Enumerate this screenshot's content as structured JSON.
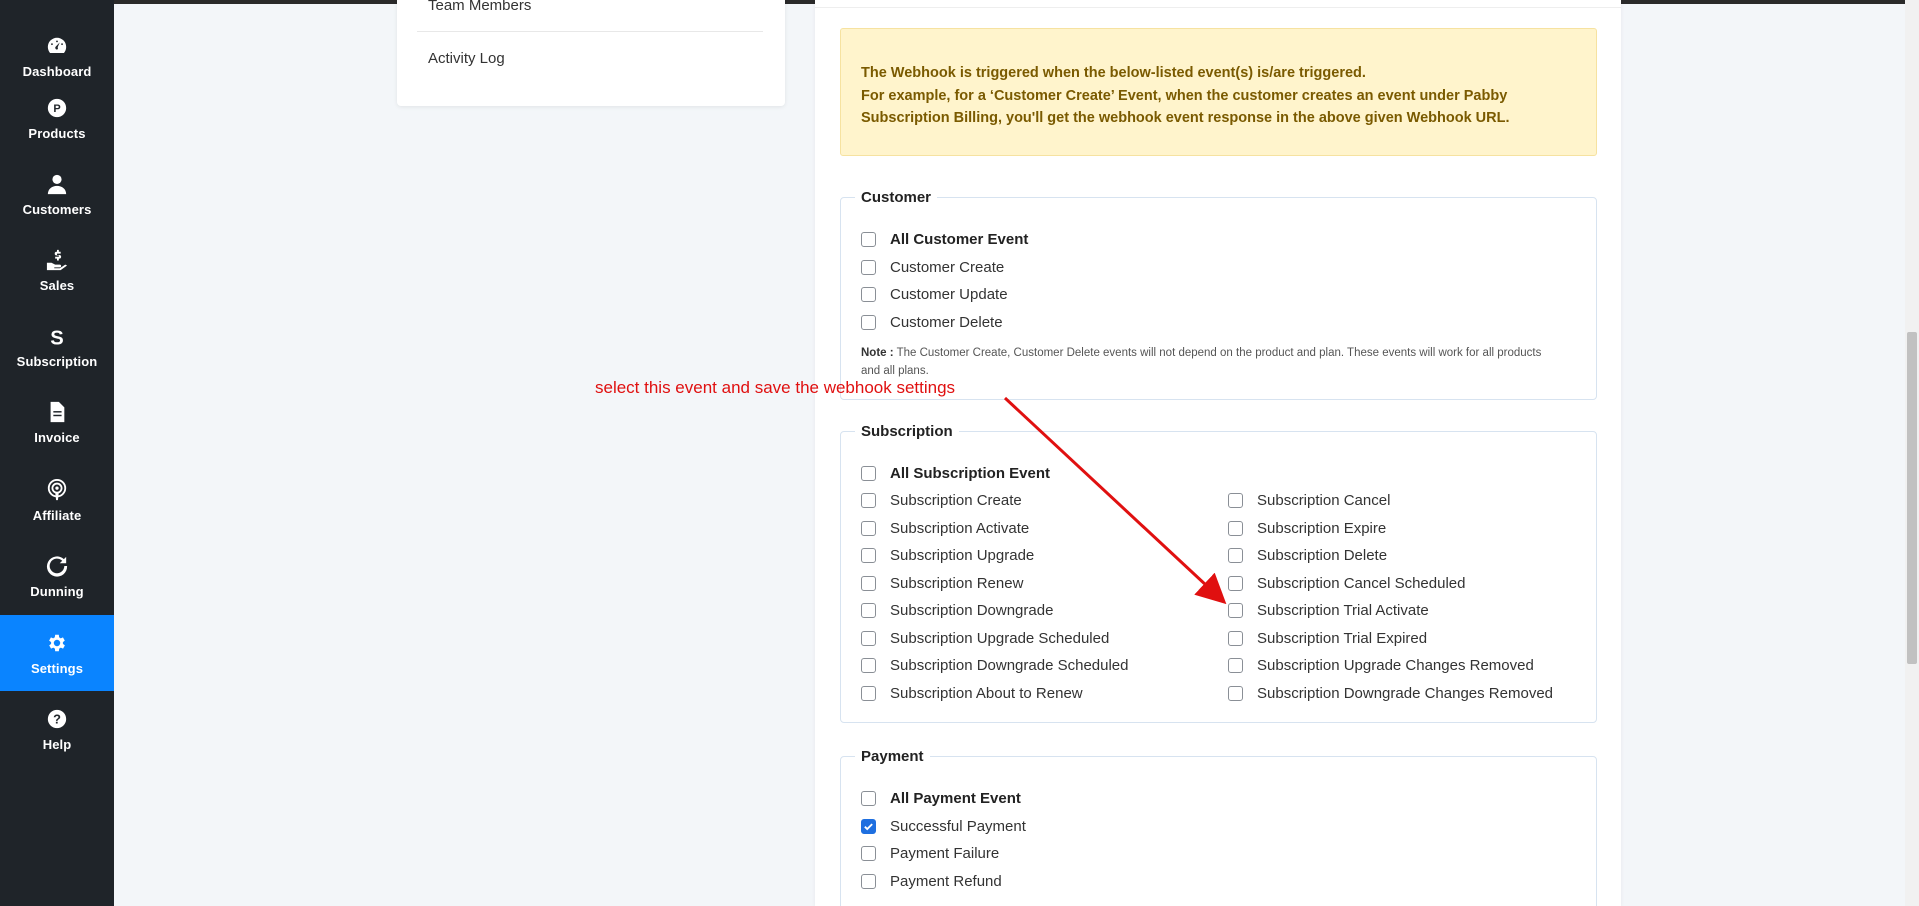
{
  "sidebar": {
    "items": [
      {
        "label": "Dashboard",
        "icon": "dashboard-icon"
      },
      {
        "label": "Products",
        "icon": "products-icon"
      },
      {
        "label": "Customers",
        "icon": "customers-icon"
      },
      {
        "label": "Sales",
        "icon": "sales-icon"
      },
      {
        "label": "Subscription",
        "icon": "subscription-icon"
      },
      {
        "label": "Invoice",
        "icon": "invoice-icon"
      },
      {
        "label": "Affiliate",
        "icon": "affiliate-icon"
      },
      {
        "label": "Dunning",
        "icon": "dunning-icon"
      },
      {
        "label": "Settings",
        "icon": "gear-icon"
      },
      {
        "label": "Help",
        "icon": "help-icon"
      }
    ],
    "active": "Settings",
    "active_color": "#0a84ff"
  },
  "settings_menu": {
    "items": [
      "Team Members",
      "Activity Log"
    ]
  },
  "info": {
    "line1": "The Webhook is triggered when the below-listed event(s) is/are triggered.",
    "line2": "For example, for a ‘Customer Create’ Event, when the customer creates an event under Pabby Subscription Billing, you'll get the webhook event response in the above given Webhook URL."
  },
  "customer": {
    "legend": "Customer",
    "all": "All Customer Event",
    "events": [
      "Customer Create",
      "Customer Update",
      "Customer Delete"
    ],
    "note_label": "Note :",
    "note_text": "The Customer Create, Customer Delete events will not depend on the product and plan. These events will work for all products and all plans."
  },
  "subscription": {
    "legend": "Subscription",
    "all": "All Subscription Event",
    "left": [
      "Subscription Create",
      "Subscription Activate",
      "Subscription Upgrade",
      "Subscription Renew",
      "Subscription Downgrade",
      "Subscription Upgrade Scheduled",
      "Subscription Downgrade Scheduled",
      "Subscription About to Renew"
    ],
    "right": [
      "Subscription Cancel",
      "Subscription Expire",
      "Subscription Delete",
      "Subscription Cancel Scheduled",
      "Subscription Trial Activate",
      "Subscription Trial Expired",
      "Subscription Upgrade Changes Removed",
      "Subscription Downgrade Changes Removed"
    ]
  },
  "payment": {
    "legend": "Payment",
    "all": "All Payment Event",
    "events": [
      "Successful Payment",
      "Payment Failure",
      "Payment Refund"
    ],
    "checked": "Successful Payment"
  },
  "annotation": {
    "text": "select this event and save the webhook settings",
    "color": "#e01010"
  }
}
